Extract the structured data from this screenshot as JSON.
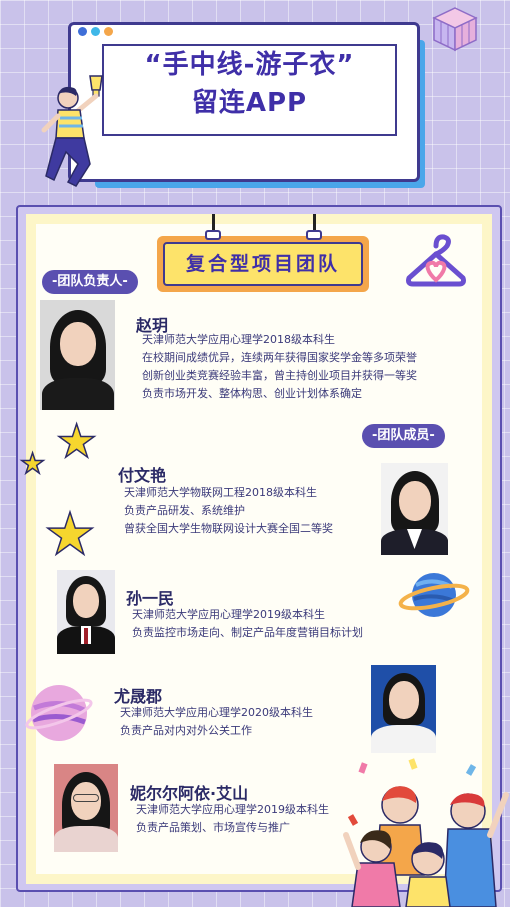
{
  "header": {
    "title_line1": "“手中线-游子衣”",
    "title_line2": "留连APP"
  },
  "team_title": "复合型项目团队",
  "leader_label": "-团队负责人-",
  "members_label": "-团队成员-",
  "leader": {
    "name": "赵玥",
    "lines": [
      "天津师范大学应用心理学2018级本科生",
      "在校期间成绩优异，连续两年获得国家奖学金等多项荣誉",
      "创新创业类竞赛经验丰富，曾主持创业项目并获得一等奖",
      "负责市场开发、整体构思、创业计划体系确定"
    ]
  },
  "members": [
    {
      "name": "付文艳",
      "lines": [
        "天津师范大学物联网工程2018级本科生",
        "负责产品研发、系统维护",
        "曾获全国大学生物联网设计大赛全国二等奖"
      ]
    },
    {
      "name": "孙一民",
      "lines": [
        "天津师范大学应用心理学2019级本科生",
        "负责监控市场走向、制定产品年度营销目标计划"
      ]
    },
    {
      "name": "尤晟郡",
      "lines": [
        "天津师范大学应用心理学2020级本科生",
        "负责产品对内对外公关工作"
      ]
    },
    {
      "name": "妮尔尔阿依·艾山",
      "lines": [
        "天津师范大学应用心理学2019级本科生",
        "负责产品策划、市场宣传与推广"
      ]
    }
  ],
  "icons": [
    "cube-icon",
    "trophy-person-illustration",
    "star-icon",
    "planet-icon",
    "hanger-heart-logo",
    "cheering-crowd-illustration"
  ],
  "colors": {
    "accent": "#3f2fa8",
    "banner": "#fde36a",
    "background": "#c9c2ea"
  }
}
